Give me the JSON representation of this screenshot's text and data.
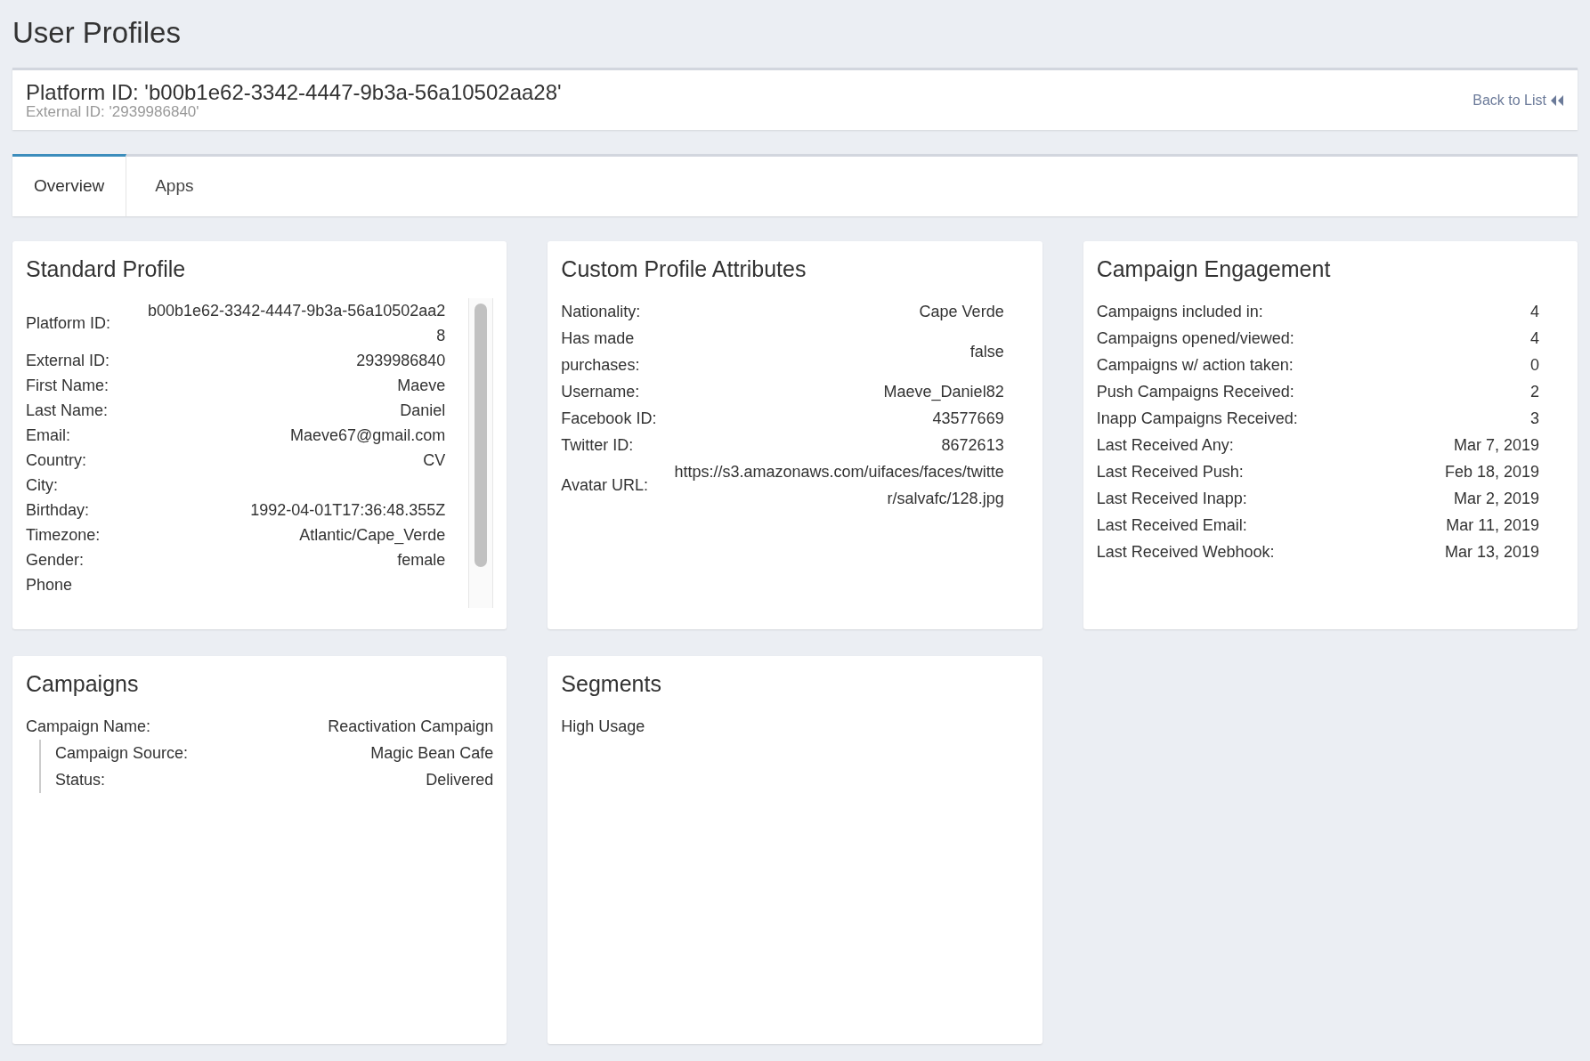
{
  "page_title": "User Profiles",
  "header": {
    "platform_id": "Platform ID: 'b00b1e62-3342-4447-9b3a-56a10502aa28'",
    "external_id": "External ID: '2939986840'",
    "back_link": "Back to List"
  },
  "tabs": [
    {
      "label": "Overview",
      "selected": true
    },
    {
      "label": "Apps",
      "selected": false
    }
  ],
  "standard_profile": {
    "title": "Standard Profile",
    "rows": [
      {
        "label": "Platform ID:",
        "value": "b00b1e62-3342-4447-9b3a-56a10502aa28"
      },
      {
        "label": "External ID:",
        "value": "2939986840"
      },
      {
        "label": "First Name:",
        "value": "Maeve"
      },
      {
        "label": "Last Name:",
        "value": "Daniel"
      },
      {
        "label": "Email:",
        "value": "Maeve67@gmail.com"
      },
      {
        "label": "Country:",
        "value": "CV"
      },
      {
        "label": "City:"
      },
      {
        "label": "Birthday:",
        "value": "1992-04-01T17:36:48.355Z"
      },
      {
        "label": "Timezone:",
        "value": "Atlantic/Cape_Verde"
      },
      {
        "label": "Gender:",
        "value": "female"
      },
      {
        "label": "Phone"
      }
    ]
  },
  "custom_attributes": {
    "title": "Custom Profile Attributes",
    "rows": [
      {
        "label": "Nationality:",
        "value": "Cape Verde"
      },
      {
        "label": "Has made purchases:",
        "value": "false"
      },
      {
        "label": "Username:",
        "value": "Maeve_Daniel82"
      },
      {
        "label": "Facebook ID:",
        "value": "43577669"
      },
      {
        "label": "Twitter ID:",
        "value": "8672613"
      },
      {
        "label": "Avatar URL:",
        "value": "https://s3.amazonaws.com/uifaces/faces/twitter/salvafc/128.jpg"
      }
    ]
  },
  "campaign_engagement": {
    "title": "Campaign Engagement",
    "rows": [
      {
        "label": "Campaigns included in:",
        "value": "4"
      },
      {
        "label": "Campaigns opened/viewed:",
        "value": "4"
      },
      {
        "label": "Campaigns w/ action taken:",
        "value": "0"
      },
      {
        "label": "Push Campaigns Received:",
        "value": "2"
      },
      {
        "label": "Inapp Campaigns Received:",
        "value": "3"
      },
      {
        "label": "Last Received Any:",
        "value": "Mar 7, 2019"
      },
      {
        "label": "Last Received Push:",
        "value": "Feb 18, 2019"
      },
      {
        "label": "Last Received Inapp:",
        "value": "Mar 2, 2019"
      },
      {
        "label": "Last Received Email:",
        "value": "Mar 11, 2019"
      },
      {
        "label": "Last Received Webhook:",
        "value": "Mar 13, 2019"
      }
    ]
  },
  "campaigns": {
    "title": "Campaigns",
    "items": [
      {
        "label": "Campaign Name:",
        "value": "Reactivation Campaign",
        "children": [
          {
            "label": "Campaign Source:",
            "value": "Magic Bean Cafe"
          },
          {
            "label": "Status:",
            "value": "Delivered"
          }
        ]
      }
    ]
  },
  "segments": {
    "title": "Segments",
    "items": [
      "High Usage"
    ]
  }
}
